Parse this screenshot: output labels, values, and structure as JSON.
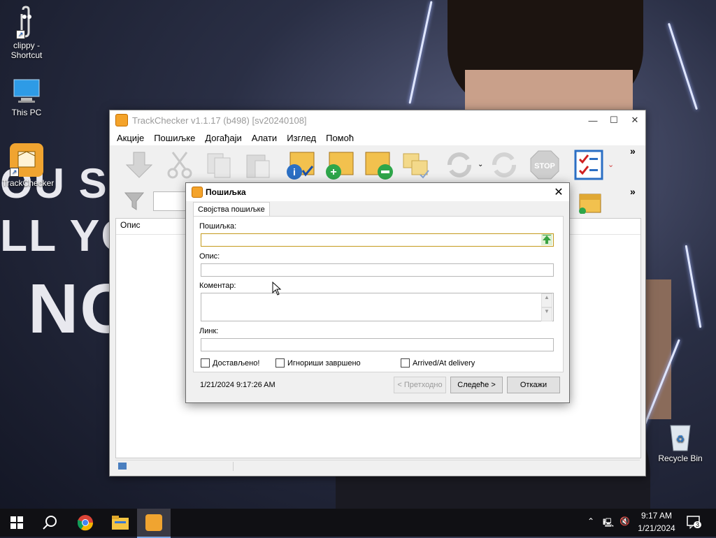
{
  "desktop": {
    "wallpaper_text": [
      "OU S",
      "LL YO",
      "NO"
    ],
    "icons": [
      {
        "label": "clippy - Shortcut",
        "icon": "paperclip-icon"
      },
      {
        "label": "This PC",
        "icon": "computer-icon"
      },
      {
        "label": "TrackChecker",
        "icon": "trackchecker-icon"
      },
      {
        "label": "Recycle Bin",
        "icon": "recycle-bin-icon"
      }
    ]
  },
  "window": {
    "title": "TrackChecker v1.1.17 (b498)  [sv20240108]",
    "menu": [
      "Акције",
      "Пошиљке",
      "Догађаји",
      "Алати",
      "Изглед",
      "Помоћ"
    ],
    "toolbar": [
      "down-arrow-icon",
      "cut-icon",
      "copy-icon",
      "paste-icon",
      "info-package-icon",
      "add-package-icon",
      "remove-package-icon",
      "packages-check-icon",
      "refresh-icon",
      "refresh-all-icon",
      "stop-icon",
      "checklist-icon"
    ],
    "toolbar_stop_text": "STOP",
    "list_header": "Опис",
    "more_glyph": "»"
  },
  "dialog": {
    "title": "Пошиљка",
    "tab": "Својства пошиљке",
    "fields": {
      "shipment_label": "Пошиљка:",
      "shipment_value": "",
      "description_label": "Опис:",
      "description_value": "",
      "comment_label": "Коментар:",
      "comment_value": "",
      "link_label": "Линк:",
      "link_value": ""
    },
    "checkboxes": {
      "delivered": "Достављено!",
      "ignore_done": "Игнориши завршено",
      "arrived": "Arrived/At delivery"
    },
    "timestamp": "1/21/2024 9:17:26 AM",
    "buttons": {
      "prev": "< Претходно",
      "next": "Следеће >",
      "cancel": "Откажи"
    }
  },
  "taskbar": {
    "time": "9:17 AM",
    "date": "1/21/2024",
    "notification_count": "3"
  }
}
